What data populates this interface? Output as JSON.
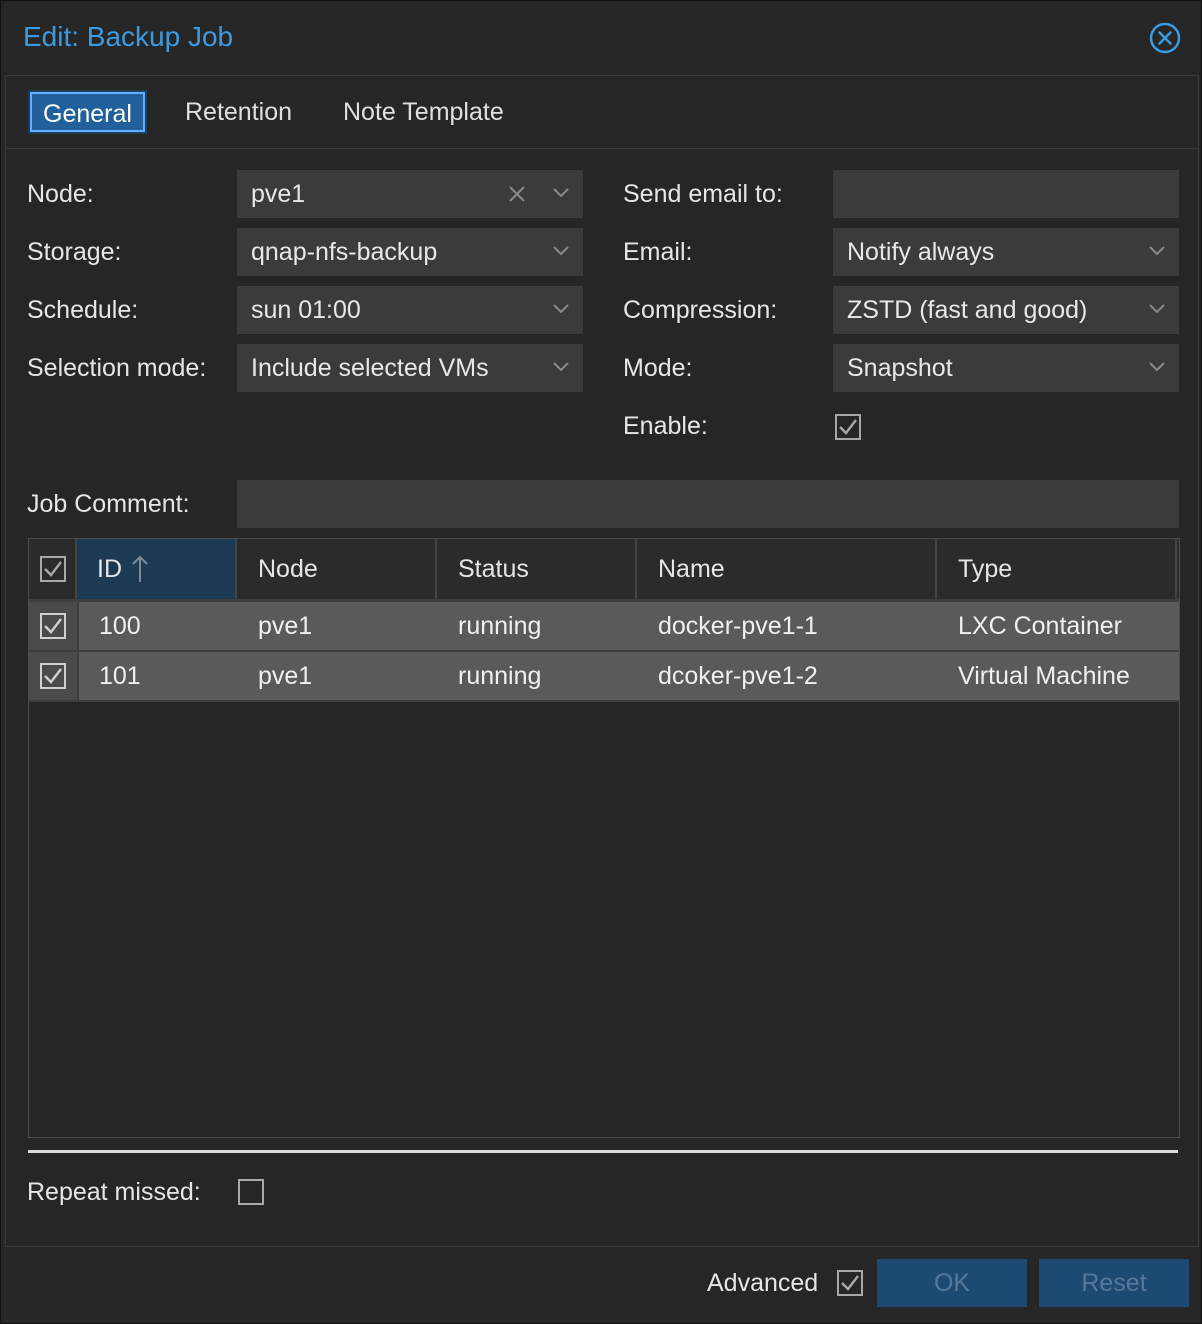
{
  "dialog": {
    "title": "Edit: Backup Job",
    "close_icon": "close-circle-icon",
    "accent": "#3d9ae0"
  },
  "tabs": [
    {
      "label": "General",
      "active": true
    },
    {
      "label": "Retention",
      "active": false
    },
    {
      "label": "Note Template",
      "active": false
    }
  ],
  "form": {
    "node": {
      "label": "Node:",
      "value": "pve1"
    },
    "storage": {
      "label": "Storage:",
      "value": "qnap-nfs-backup"
    },
    "schedule": {
      "label": "Schedule:",
      "value": "sun 01:00"
    },
    "selection_mode": {
      "label": "Selection mode:",
      "value": "Include selected VMs"
    },
    "send_email_to": {
      "label": "Send email to:",
      "value": ""
    },
    "email": {
      "label": "Email:",
      "value": "Notify always"
    },
    "compression": {
      "label": "Compression:",
      "value": "ZSTD (fast and good)"
    },
    "mode": {
      "label": "Mode:",
      "value": "Snapshot"
    },
    "enable": {
      "label": "Enable:",
      "checked": true
    },
    "job_comment": {
      "label": "Job Comment:",
      "value": ""
    }
  },
  "grid": {
    "columns": [
      "ID",
      "Node",
      "Status",
      "Name",
      "Type"
    ],
    "sort_icon": "arrow-up-icon",
    "rows": [
      {
        "checked": true,
        "id": "100",
        "node": "pve1",
        "status": "running",
        "name": "docker-pve1-1",
        "type": "LXC Container"
      },
      {
        "checked": true,
        "id": "101",
        "node": "pve1",
        "status": "running",
        "name": "dcoker-pve1-2",
        "type": "Virtual Machine"
      }
    ]
  },
  "repeat_missed": {
    "label": "Repeat missed:",
    "checked": false
  },
  "footer": {
    "advanced_label": "Advanced",
    "advanced_checked": true,
    "ok_label": "OK",
    "reset_label": "Reset"
  }
}
